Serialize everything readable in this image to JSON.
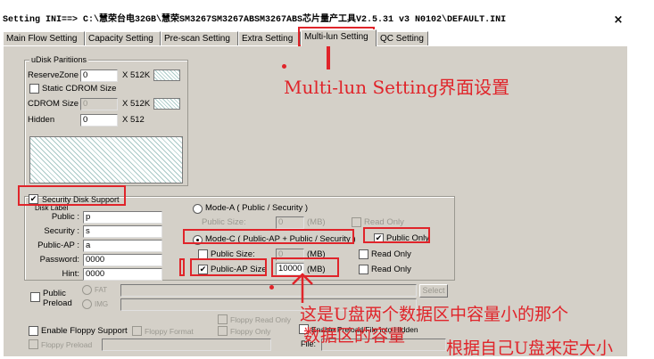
{
  "window": {
    "title": "Setting  INI==> C:\\慧荣台电32GB\\慧荣SM3267SM3267ABSM3267ABS芯片量产工具V2.5.31 v3 N0102\\DEFAULT.INI",
    "close_glyph": "×"
  },
  "tabs": [
    {
      "label": "Main Flow Setting",
      "active": false
    },
    {
      "label": "Capacity Setting",
      "active": false
    },
    {
      "label": "Pre-scan Setting",
      "active": false
    },
    {
      "label": "Extra Setting",
      "active": false
    },
    {
      "label": "Multi-lun Setting",
      "active": true
    },
    {
      "label": "QC Setting",
      "active": false
    }
  ],
  "udisk": {
    "group_label": "uDisk Paritiions",
    "reserve_zone_label": "ReserveZone",
    "reserve_zone_value": "0",
    "reserve_zone_unit": "X 512K",
    "static_cdrom_label": "Static CDROM Size",
    "static_cdrom_checked": false,
    "cdrom_size_label": "CDROM Size",
    "cdrom_size_value": "0",
    "cdrom_size_unit": "X 512K",
    "hidden_label": "Hidden",
    "hidden_value": "0",
    "hidden_unit": "X 512"
  },
  "security": {
    "support_label": "Security Disk Support",
    "support_checked": true,
    "disk_label_group": "Disk Label",
    "public_label": "Public :",
    "public_value": "p",
    "security_label": "Security :",
    "security_value": "s",
    "public_ap_label": "Public-AP :",
    "public_ap_value": "a",
    "password_label": "Password:",
    "password_value": "0000",
    "hint_label": "Hint:",
    "hint_value": "0000"
  },
  "modes": {
    "mode_a_label": "Mode-A ( Public / Security )",
    "mode_a_selected": false,
    "mode_a_public_size_label": "Public Size:",
    "mode_a_public_size_value": "0",
    "mode_a_unit": "(MB)",
    "mode_a_read_only_label": "Read Only",
    "mode_c_label": "Mode-C ( Public-AP + Public / Security )",
    "mode_c_selected": true,
    "public_only_label": "Public Only",
    "public_only_checked": true,
    "public_size_label": "Public Size:",
    "public_size_value": "0",
    "public_size_unit": "(MB)",
    "public_size_read_only_label": "Read Only",
    "public_ap_size_label": "Public-AP Size",
    "public_ap_size_checked": true,
    "public_ap_size_value": "10000",
    "public_ap_size_unit": "(MB)",
    "public_ap_read_only_label": "Read Only"
  },
  "preload": {
    "public_preload_label": "Public\nPreload",
    "fat_label": "FAT",
    "img_label": "IMG",
    "select_label": "Select",
    "floppy_read_only_label": "Floppy Read Only",
    "enable_floppy_label": "Enable Floppy Support",
    "floppy_format_label": "Floppy Format",
    "floppy_only_label": "Floppy Only",
    "floppy_preload_label": "Floppy Preload",
    "enable_preload_hidden_label": "Enable Preload File into Hidden",
    "file_label": "File:"
  },
  "annotations": {
    "heading": "Multi-lun Setting界面设置",
    "note_line1": "这是U盘两个数据区中容量小的那个",
    "note_line2": "数据区的容量",
    "note_line3": "根据自己U盘来定大小",
    "color": "#e0242a"
  }
}
